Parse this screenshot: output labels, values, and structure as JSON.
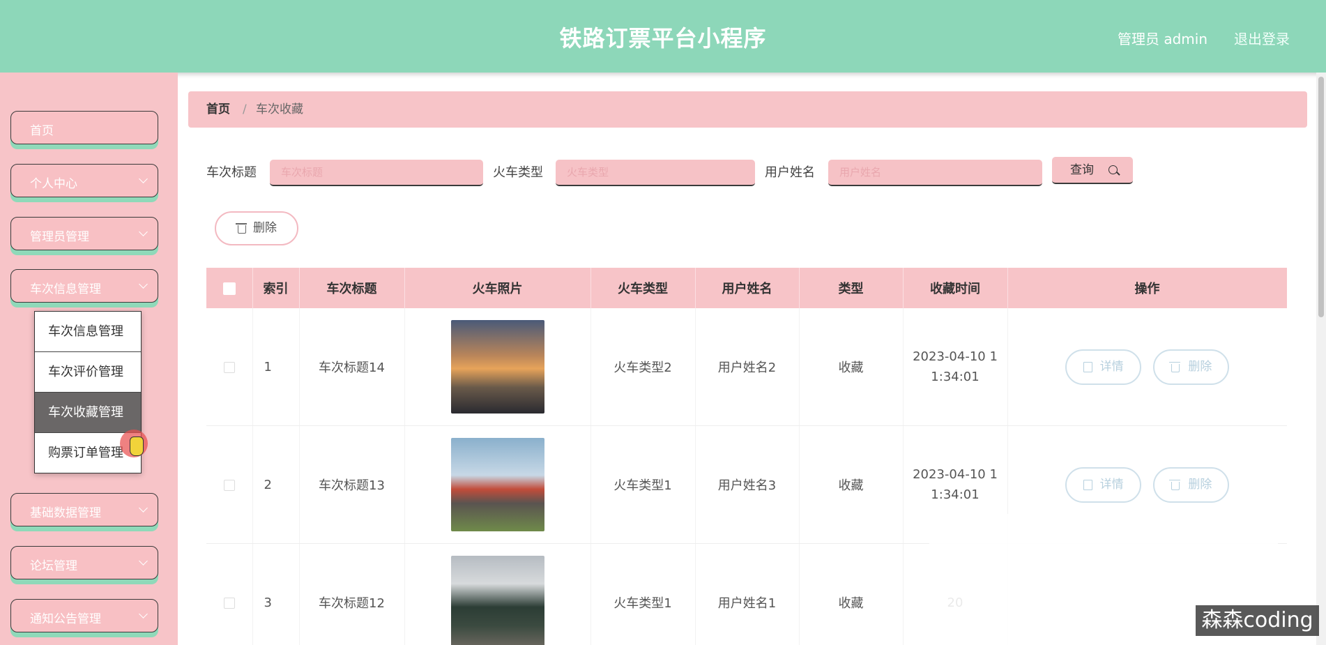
{
  "header": {
    "title": "铁路订票平台小程序",
    "user": "管理员 admin",
    "logout": "退出登录",
    "bg_color": "#8dd7b9"
  },
  "sidebar": {
    "items": [
      {
        "label": "首页",
        "has_arrow": false
      },
      {
        "label": "个人中心",
        "has_arrow": true
      },
      {
        "label": "管理员管理",
        "has_arrow": true
      },
      {
        "label": "车次信息管理",
        "has_arrow": true
      },
      {
        "label": "基础数据管理",
        "has_arrow": true
      },
      {
        "label": "论坛管理",
        "has_arrow": true
      },
      {
        "label": "通知公告管理",
        "has_arrow": true
      }
    ],
    "submenu": [
      "车次信息管理",
      "车次评价管理",
      "车次收藏管理",
      "购票订单管理"
    ],
    "submenu_active": "车次收藏管理"
  },
  "breadcrumb": {
    "home": "首页",
    "current": "车次收藏"
  },
  "filters": {
    "labels": [
      "车次标题",
      "火车类型",
      "用户姓名"
    ],
    "placeholders": [
      "车次标题",
      "火车类型",
      "用户姓名"
    ],
    "query_label": "查询"
  },
  "toolbar": {
    "delete_label": "删除"
  },
  "table": {
    "headers": [
      "索引",
      "车次标题",
      "火车照片",
      "火车类型",
      "用户姓名",
      "类型",
      "收藏时间",
      "操作"
    ],
    "rows": [
      {
        "index": "1",
        "title": "车次标题14",
        "train_type": "火车类型2",
        "user": "用户姓名2",
        "type": "收藏",
        "time": "2023-04-10 11:34:01"
      },
      {
        "index": "2",
        "title": "车次标题13",
        "train_type": "火车类型1",
        "user": "用户姓名3",
        "type": "收藏",
        "time": "2023-04-10 11:34:01"
      },
      {
        "index": "3",
        "title": "车次标题12",
        "train_type": "火车类型1",
        "user": "用户姓名1",
        "type": "收藏",
        "time": "20"
      }
    ],
    "detail_label": "详情",
    "row_delete_label": "删除"
  },
  "watermark": "森森coding"
}
